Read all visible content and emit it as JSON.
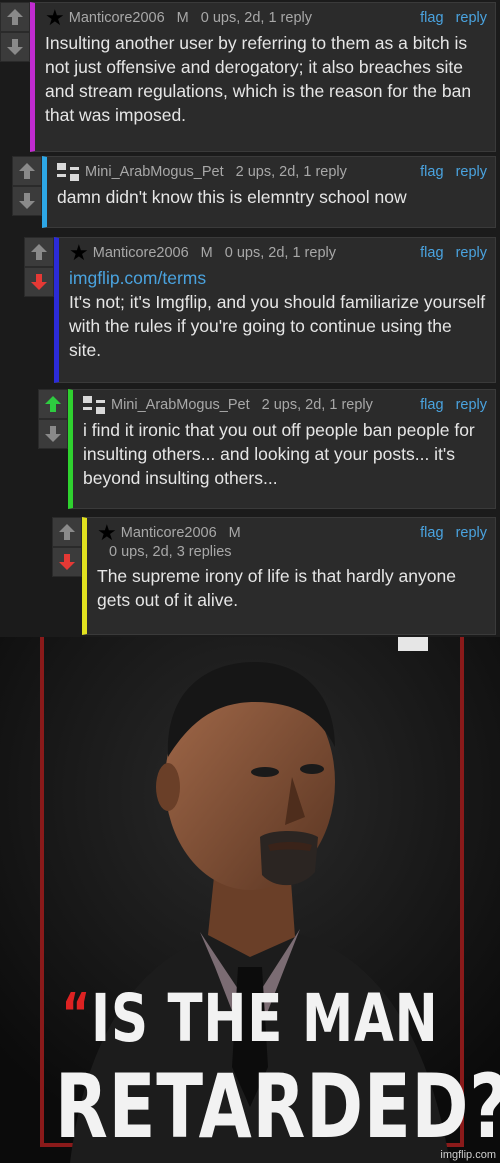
{
  "colors": {
    "accent_link": "#4aa3df",
    "border_1": "#c12bd1",
    "border_2": "#2da7e6",
    "border_3": "#2b2bd9",
    "border_4": "#2fd12f",
    "border_5": "#e1e11f",
    "upvote_active": "#2ecc40",
    "downvote_active": "#e53935"
  },
  "comments": [
    {
      "user": "Manticore2006",
      "mod_label": "M",
      "meta": "0 ups, 2d, 1 reply",
      "flag": "flag",
      "reply": "reply",
      "text": "Insulting another user by referring to them as a bitch is not just offensive and derogatory; it also breaches site and stream regulations, which is the reason for the ban that was imposed.",
      "icon": "star-icon"
    },
    {
      "user": "Mini_ArabMogus_Pet",
      "meta": "2 ups, 2d, 1 reply",
      "flag": "flag",
      "reply": "reply",
      "text": "damn didn't know this is elemntry school now",
      "icon": "cross-glyph-icon"
    },
    {
      "user": "Manticore2006",
      "mod_label": "M",
      "meta": "0 ups, 2d, 1 reply",
      "flag": "flag",
      "reply": "reply",
      "link": "imgflip.com/terms",
      "text": "It's not; it's Imgflip, and you should familiarize yourself with the rules if you're going to continue using the site.",
      "icon": "star-icon"
    },
    {
      "user": "Mini_ArabMogus_Pet",
      "meta": "2 ups, 2d, 1 reply",
      "flag": "flag",
      "reply": "reply",
      "text": "i find it ironic that you out off people ban people for insulting others... and looking at your posts... it's beyond insulting others...",
      "icon": "cross-glyph-icon"
    },
    {
      "user": "Manticore2006",
      "mod_label": "M",
      "meta": "0 ups, 2d, 3 replies",
      "flag": "flag",
      "reply": "reply",
      "text": "The supreme irony of life is that hardly anyone gets out of it alive.",
      "icon": "star-icon"
    }
  ],
  "meme": {
    "quote_mark": "“",
    "line1": "IS THE MAN",
    "line2": "RETARDED?",
    "watermark": "imgflip.com"
  }
}
